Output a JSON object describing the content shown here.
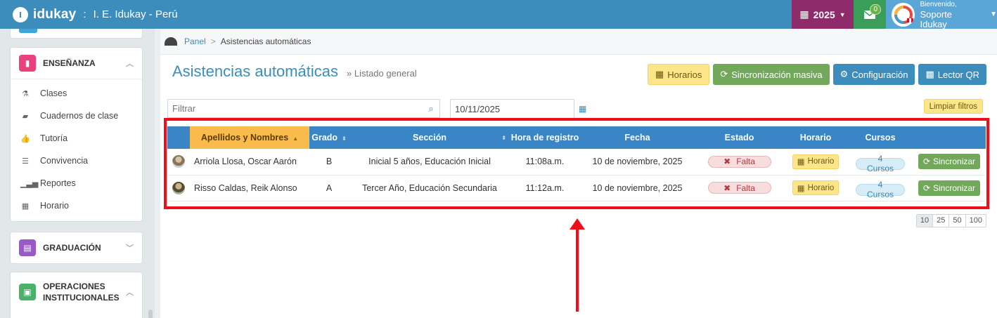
{
  "topbar": {
    "logo_text": "idukay",
    "separator": ":",
    "school_name": "I. E. Idukay - Perú",
    "year": "2025",
    "mail_count": "0",
    "user_greeting": "Bienvenido,",
    "user_name": "Soporte Idukay"
  },
  "sidebar": {
    "sections": [
      {
        "label": "ENSEÑANZA",
        "color": "#e8417e",
        "items": [
          {
            "icon": "flask-icon",
            "label": "Clases"
          },
          {
            "icon": "book-icon",
            "label": "Cuadernos de clase"
          },
          {
            "icon": "thumbs-up-icon",
            "label": "Tutoría"
          },
          {
            "icon": "list-icon",
            "label": "Convivencia"
          },
          {
            "icon": "bar-chart-icon",
            "label": "Reportes"
          },
          {
            "icon": "calendar-icon",
            "label": "Horario"
          }
        ]
      },
      {
        "label": "GRADUACIÓN",
        "color": "#9b59c8"
      },
      {
        "label_line1": "OPERACIONES",
        "label_line2": "INSTITUCIONALES",
        "color": "#4cb06d"
      }
    ]
  },
  "breadcrumb": {
    "root": "Panel",
    "separator": ">",
    "current": "Asistencias automáticas"
  },
  "page": {
    "title": "Asistencias automáticas",
    "subtitle": "» Listado general"
  },
  "actions": {
    "horarios": "Horarios",
    "sync_all": "Sincronización masiva",
    "config": "Configuración",
    "qr": "Lector QR"
  },
  "filters": {
    "search_placeholder": "Filtrar",
    "date_value": "10/11/2025",
    "clear": "Limpiar filtros"
  },
  "table": {
    "headers": [
      "Apellidos y Nombres",
      "Grado",
      "Sección",
      "Hora de registro",
      "Fecha",
      "Estado",
      "Horario",
      "Cursos"
    ],
    "rows": [
      {
        "name": "Arriola Llosa, Oscar Aarón",
        "grade": "B",
        "section": "Inicial 5 años, Educación Inicial",
        "time": "11:08a.m.",
        "date": "10 de noviembre, 2025",
        "status": "Falta",
        "schedule": "Horario",
        "courses": "4 Cursos",
        "action": "Sincronizar"
      },
      {
        "name": "Risso Caldas, Reik Alonso",
        "grade": "A",
        "section": "Tercer Año, Educación Secundaria",
        "time": "11:12a.m.",
        "date": "10 de noviembre, 2025",
        "status": "Falta",
        "schedule": "Horario",
        "courses": "4 Cursos",
        "action": "Sincronizar"
      }
    ]
  },
  "pager": [
    "10",
    "25",
    "50",
    "100"
  ]
}
